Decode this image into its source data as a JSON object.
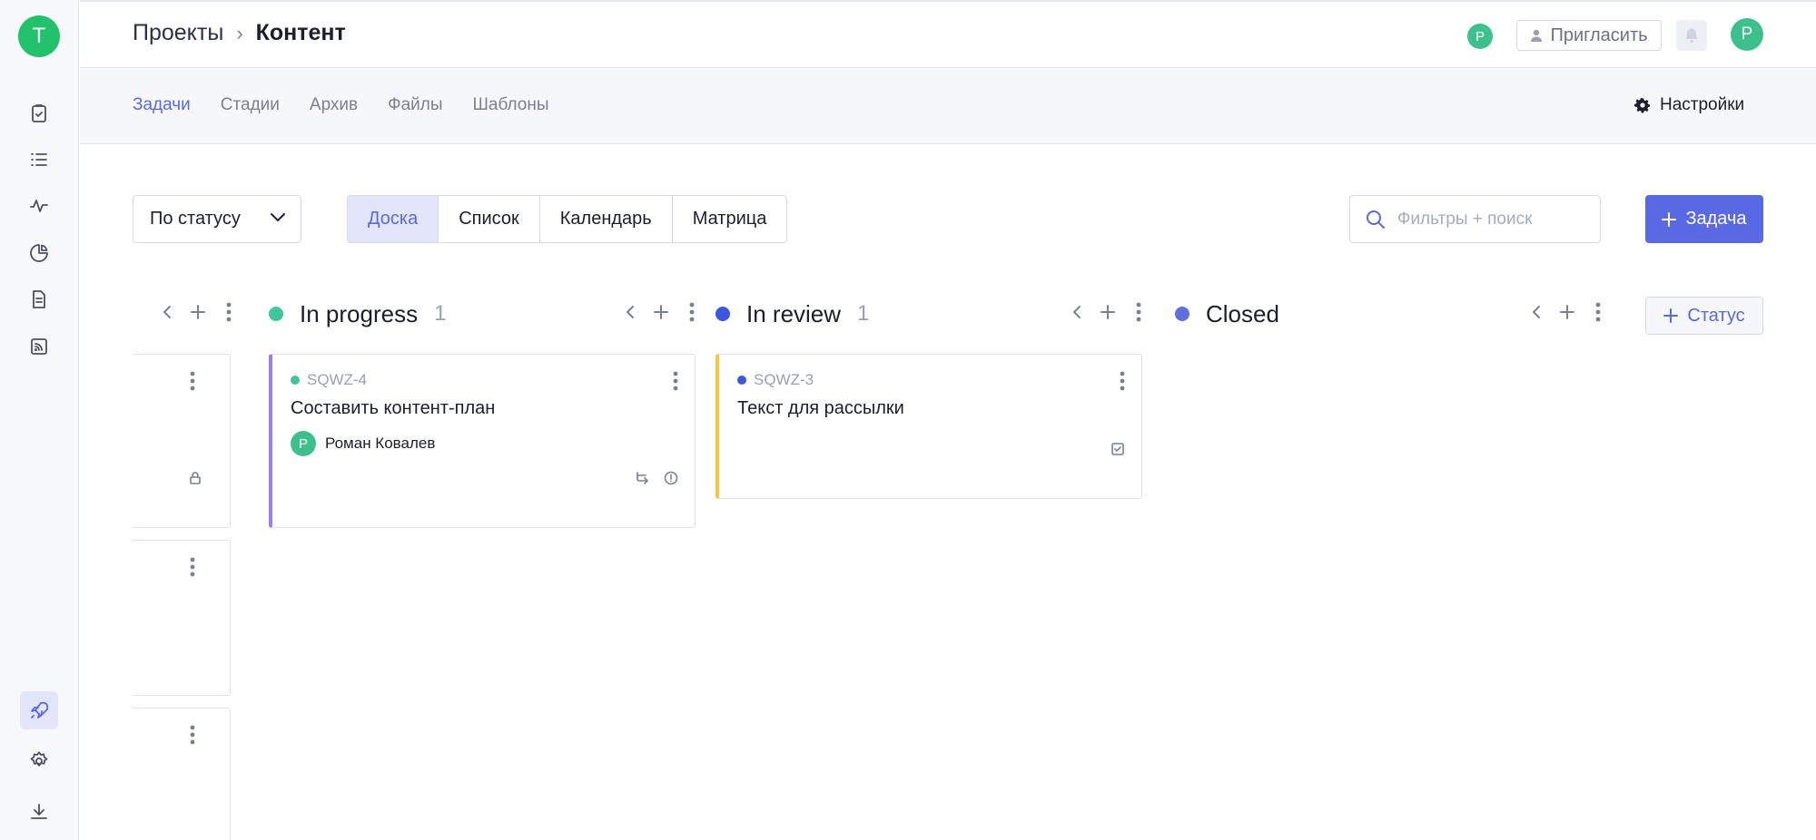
{
  "workspace": {
    "initial": "T",
    "color": "#22c16b"
  },
  "rail": {
    "items": [
      {
        "name": "clipboard-check-icon"
      },
      {
        "name": "list-icon"
      },
      {
        "name": "activity-icon"
      },
      {
        "name": "pie-chart-icon"
      },
      {
        "name": "document-icon"
      },
      {
        "name": "rss-icon"
      },
      {
        "name": "rocket-icon",
        "active": true
      },
      {
        "name": "gear-icon"
      },
      {
        "name": "download-icon"
      }
    ]
  },
  "header": {
    "breadcrumb_parent": "Проекты",
    "breadcrumb_separator": "›",
    "breadcrumb_current": "Контент",
    "member_initial": "Р",
    "invite_label": "Пригласить",
    "user_initial": "Р"
  },
  "subnav": {
    "tabs": [
      {
        "label": "Задачи",
        "active": true
      },
      {
        "label": "Стадии"
      },
      {
        "label": "Архив"
      },
      {
        "label": "Файлы"
      },
      {
        "label": "Шаблоны"
      }
    ],
    "settings_label": "Настройки"
  },
  "toolbar": {
    "group_by": "По статусу",
    "views": [
      {
        "label": "Доска",
        "active": true
      },
      {
        "label": "Список"
      },
      {
        "label": "Календарь"
      },
      {
        "label": "Матрица"
      }
    ],
    "search_placeholder": "Фильтры + поиск",
    "add_task_label": "Задача"
  },
  "board": {
    "columns": [
      {
        "title": "In progress",
        "count": "1",
        "color": "#3ec69d"
      },
      {
        "title": "In review",
        "count": "1",
        "color": "#3a57e3"
      },
      {
        "title": "Closed",
        "count": "",
        "color": "#5d6ee0"
      }
    ],
    "add_status_label": "Статус",
    "cards": [
      {
        "key": "SQWZ-4",
        "key_color": "#3ec69d",
        "title": "Составить контент-план",
        "assignee": "Роман Ковалев",
        "assignee_initial": "Р",
        "accent": "#9a7ef0"
      },
      {
        "key": "SQWZ-3",
        "key_color": "#3a57e3",
        "title": "Текст для рассылки",
        "accent": "#f5c842"
      }
    ]
  }
}
